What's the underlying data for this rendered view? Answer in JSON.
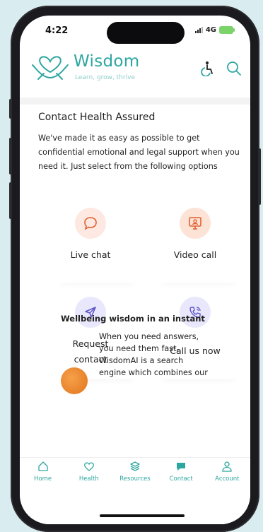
{
  "status": {
    "time": "4:22",
    "network": "4G"
  },
  "header": {
    "brand": "Wisdom",
    "tagline": "Learn, grow, thrive"
  },
  "section": {
    "title": "Contact Health Assured",
    "description": "We've made it as easy as possible to get confidential emotional and legal support when you need it. Just select from the following options"
  },
  "options": [
    {
      "label": "Live chat",
      "icon": "chat-bubble-icon"
    },
    {
      "label": "Video call",
      "icon": "video-call-icon"
    },
    {
      "label": "Request contact",
      "icon": "send-icon"
    },
    {
      "label": "Call us now",
      "icon": "phone-icon"
    }
  ],
  "wellbeing": {
    "title": "Wellbeing wisdom in an instant",
    "text": "When you need answers, you need them fast. WisdomAI is a search engine which combines our"
  },
  "tabs": [
    {
      "label": "Home",
      "icon": "home-icon"
    },
    {
      "label": "Health",
      "icon": "heart-icon"
    },
    {
      "label": "Resources",
      "icon": "layers-icon"
    },
    {
      "label": "Contact",
      "icon": "chat-icon"
    },
    {
      "label": "Account",
      "icon": "person-icon"
    }
  ],
  "colors": {
    "accent": "#2ea6a0",
    "chat_bg": "#fde8e2",
    "video_bg": "#fde2d6",
    "request_bg": "#e9e7fb",
    "call_bg": "#e9e7fb",
    "background": "#d9ecef"
  }
}
